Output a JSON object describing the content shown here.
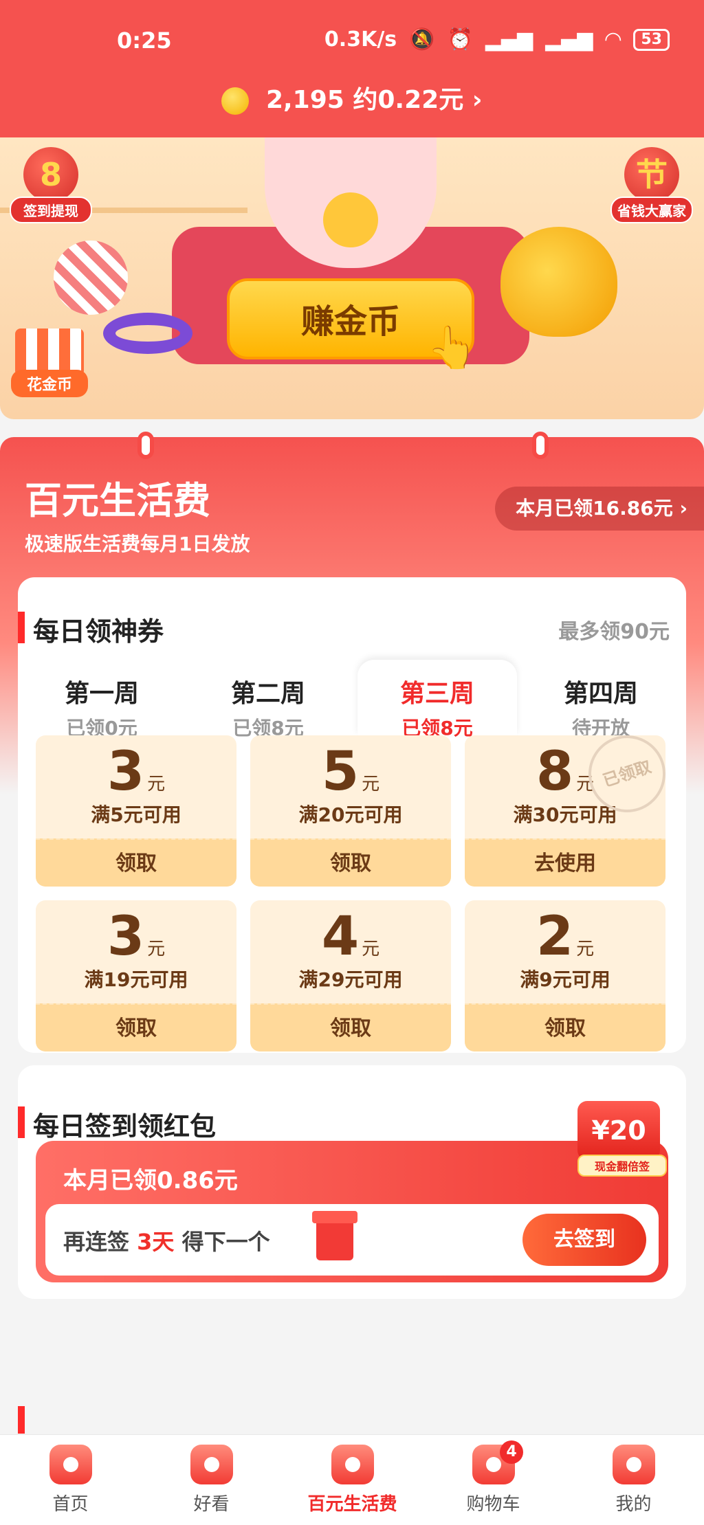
{
  "status_bar": {
    "time": "0:25",
    "net_speed": "0.3K/s",
    "icons": [
      "mute-icon",
      "alarm-icon",
      "hd-signal-icon",
      "hd-signal-icon",
      "wifi-icon"
    ],
    "battery": "53"
  },
  "coins": {
    "count": "2,195",
    "approx": "约0.22元",
    "chevron": "›"
  },
  "hero": {
    "signin_badge_num": "8",
    "signin_badge_label": "签到提现",
    "festival_badge_char": "节",
    "festival_badge_label": "省钱大赢家",
    "earn_button": "赚金币",
    "spend_label": "花金币"
  },
  "section": {
    "title": "百元生活费",
    "subtitle": "极速版生活费每月1日发放",
    "claimed": "本月已领16.86元 ›"
  },
  "daily_coupon": {
    "title": "每日领神券",
    "max": "最多领90元",
    "weeks": [
      {
        "name": "第一周",
        "status": "已领0元"
      },
      {
        "name": "第二周",
        "status": "已领8元"
      },
      {
        "name": "第三周",
        "status": "已领8元"
      },
      {
        "name": "第四周",
        "status": "待开放"
      }
    ],
    "coupons": [
      {
        "value": "3",
        "unit": "元",
        "cond": "满5元可用",
        "btn": "领取"
      },
      {
        "value": "5",
        "unit": "元",
        "cond": "满20元可用",
        "btn": "领取"
      },
      {
        "value": "8",
        "unit": "元",
        "cond": "满30元可用",
        "btn": "去使用",
        "stamp": "已领取"
      },
      {
        "value": "3",
        "unit": "元",
        "cond": "满19元可用",
        "btn": "领取"
      },
      {
        "value": "4",
        "unit": "元",
        "cond": "满29元可用",
        "btn": "领取"
      },
      {
        "value": "2",
        "unit": "元",
        "cond": "满9元可用",
        "btn": "领取"
      }
    ]
  },
  "daily_sign": {
    "title": "每日签到领红包",
    "month_claimed": "本月已领0.86元",
    "text_pre": "再连签",
    "days": "3天",
    "text_post": "得下一个",
    "button": "去签到"
  },
  "float_ad": {
    "amount": "¥20",
    "tag": "现金翻倍签"
  },
  "nav": [
    {
      "label": "首页"
    },
    {
      "label": "好看"
    },
    {
      "label": "百元生活费"
    },
    {
      "label": "购物车",
      "count": "4"
    },
    {
      "label": "我的"
    }
  ],
  "colors": {
    "brand_red": "#f5524f",
    "accent_red": "#f12b2b",
    "coupon_bg": "#fff1dc",
    "coupon_text": "#6b3a16"
  }
}
